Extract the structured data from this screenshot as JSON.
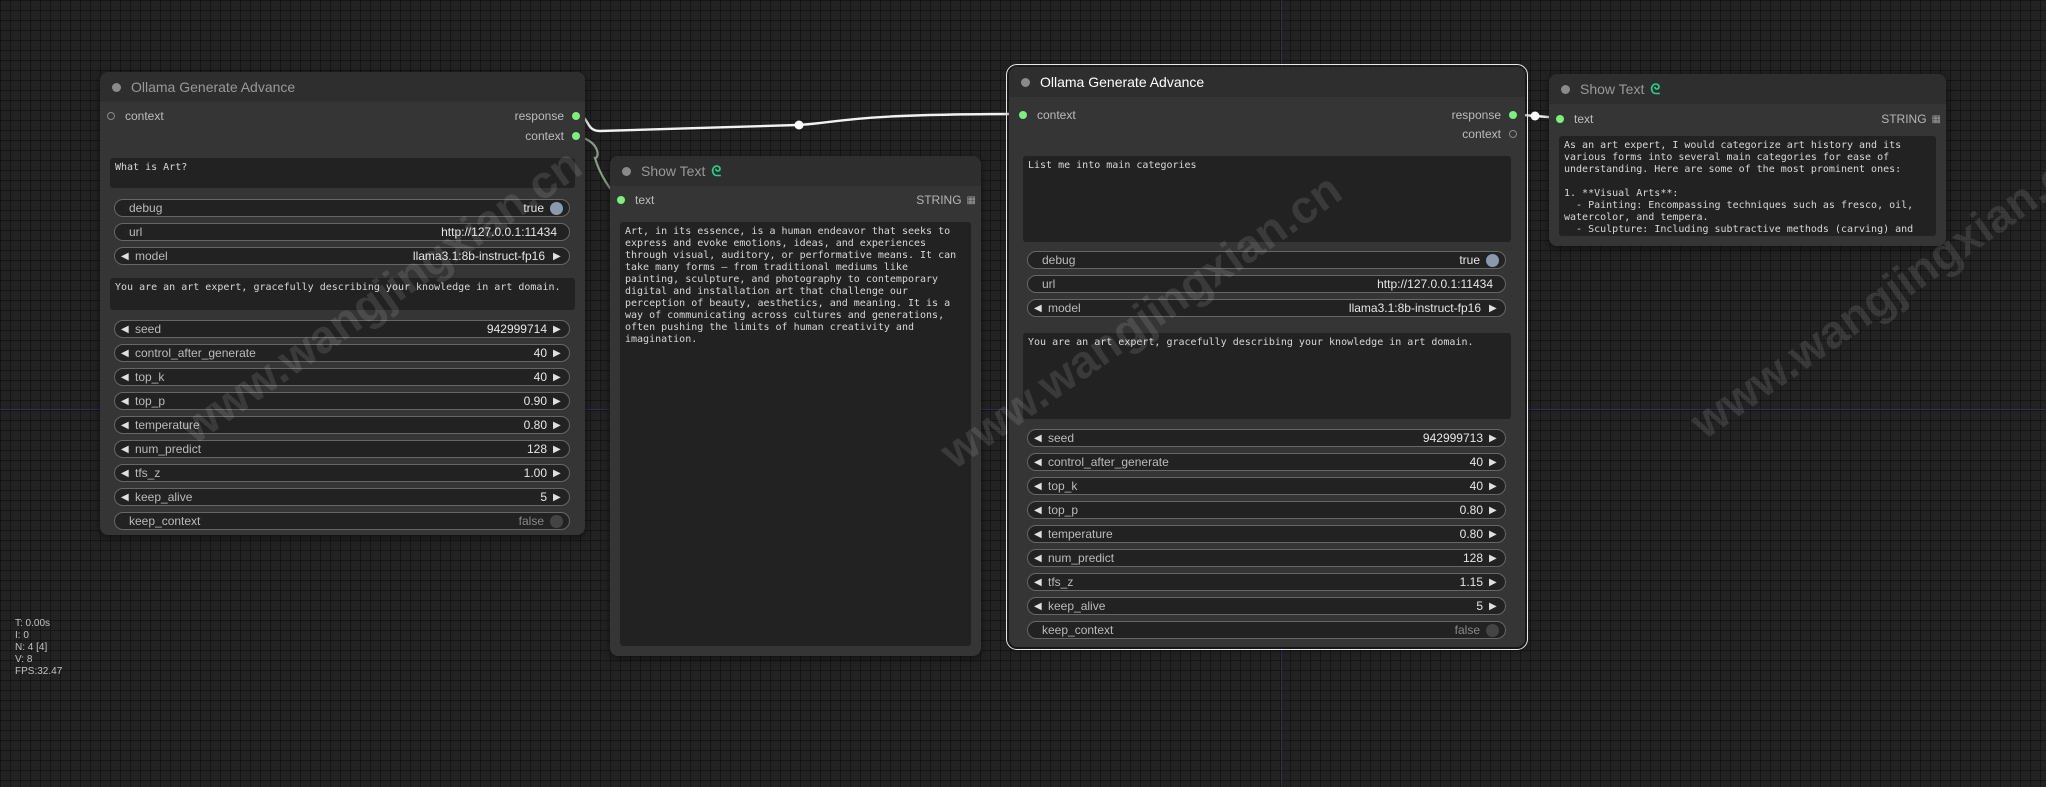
{
  "watermark": "www.wangjingxian.cn",
  "stats": [
    "T: 0.00s",
    "I: 0",
    "N: 4 [4]",
    "V: 8",
    "FPS:32.47"
  ],
  "node1": {
    "title": "Ollama Generate Advance",
    "input_context": "context",
    "output_response": "response",
    "output_context": "context",
    "prompt": "What is Art?",
    "debug": {
      "label": "debug",
      "value": "true"
    },
    "url": {
      "label": "url",
      "value": "http://127.0.0.1:11434"
    },
    "model": {
      "label": "model",
      "value": "llama3.1:8b-instruct-fp16"
    },
    "system": "You are an art expert, gracefully describing your knowledge in art domain.",
    "seed": {
      "label": "seed",
      "value": "942999714"
    },
    "control_after_generate": {
      "label": "control_after_generate",
      "value": "40"
    },
    "top_k": {
      "label": "top_k",
      "value": "40"
    },
    "top_p": {
      "label": "top_p",
      "value": "0.90"
    },
    "temperature": {
      "label": "temperature",
      "value": "0.80"
    },
    "num_predict": {
      "label": "num_predict",
      "value": "128"
    },
    "tfs_z": {
      "label": "tfs_z",
      "value": "1.00"
    },
    "keep_alive": {
      "label": "keep_alive",
      "value": "5"
    },
    "keep_context": {
      "label": "keep_context",
      "value": "false"
    }
  },
  "node2": {
    "title": "Show Text",
    "title_icon": "link-icon",
    "input_text": "text",
    "output_type": "STRING",
    "text": "Art, in its essence, is a human endeavor that seeks to express and evoke emotions, ideas, and experiences through visual, auditory, or performative means. It can take many forms – from traditional mediums like painting, sculpture, and photography to contemporary digital and installation art that challenge our perception of beauty, aesthetics, and meaning. It is a way of communicating across cultures and generations, often pushing the limits of human creativity and imagination."
  },
  "node3": {
    "title": "Ollama Generate Advance",
    "input_context": "context",
    "output_response": "response",
    "output_context": "context",
    "prompt": "List me into main categories",
    "debug": {
      "label": "debug",
      "value": "true"
    },
    "url": {
      "label": "url",
      "value": "http://127.0.0.1:11434"
    },
    "model": {
      "label": "model",
      "value": "llama3.1:8b-instruct-fp16"
    },
    "system": "You are an art expert, gracefully describing your knowledge in art domain.",
    "seed": {
      "label": "seed",
      "value": "942999713"
    },
    "control_after_generate": {
      "label": "control_after_generate",
      "value": "40"
    },
    "top_k": {
      "label": "top_k",
      "value": "40"
    },
    "top_p": {
      "label": "top_p",
      "value": "0.80"
    },
    "temperature": {
      "label": "temperature",
      "value": "0.80"
    },
    "num_predict": {
      "label": "num_predict",
      "value": "128"
    },
    "tfs_z": {
      "label": "tfs_z",
      "value": "1.15"
    },
    "keep_alive": {
      "label": "keep_alive",
      "value": "5"
    },
    "keep_context": {
      "label": "keep_context",
      "value": "false"
    }
  },
  "node4": {
    "title": "Show Text",
    "title_icon": "link-icon",
    "input_text": "text",
    "output_type": "STRING",
    "text": "As an art expert, I would categorize art history and its various forms into several main categories for ease of understanding. Here are some of the most prominent ones:\n\n1. **Visual Arts**:\n  - Painting: Encompassing techniques such as fresco, oil, watercolor, and tempera.\n  - Sculpture: Including subtractive methods (carving) and additive methods (modeling) in stone, metal, wood, clay, and more recently, digital tools."
  },
  "colors": {
    "link": "#ffffff",
    "slot": "#7cf07c",
    "accent_icon": "#27d08a"
  }
}
